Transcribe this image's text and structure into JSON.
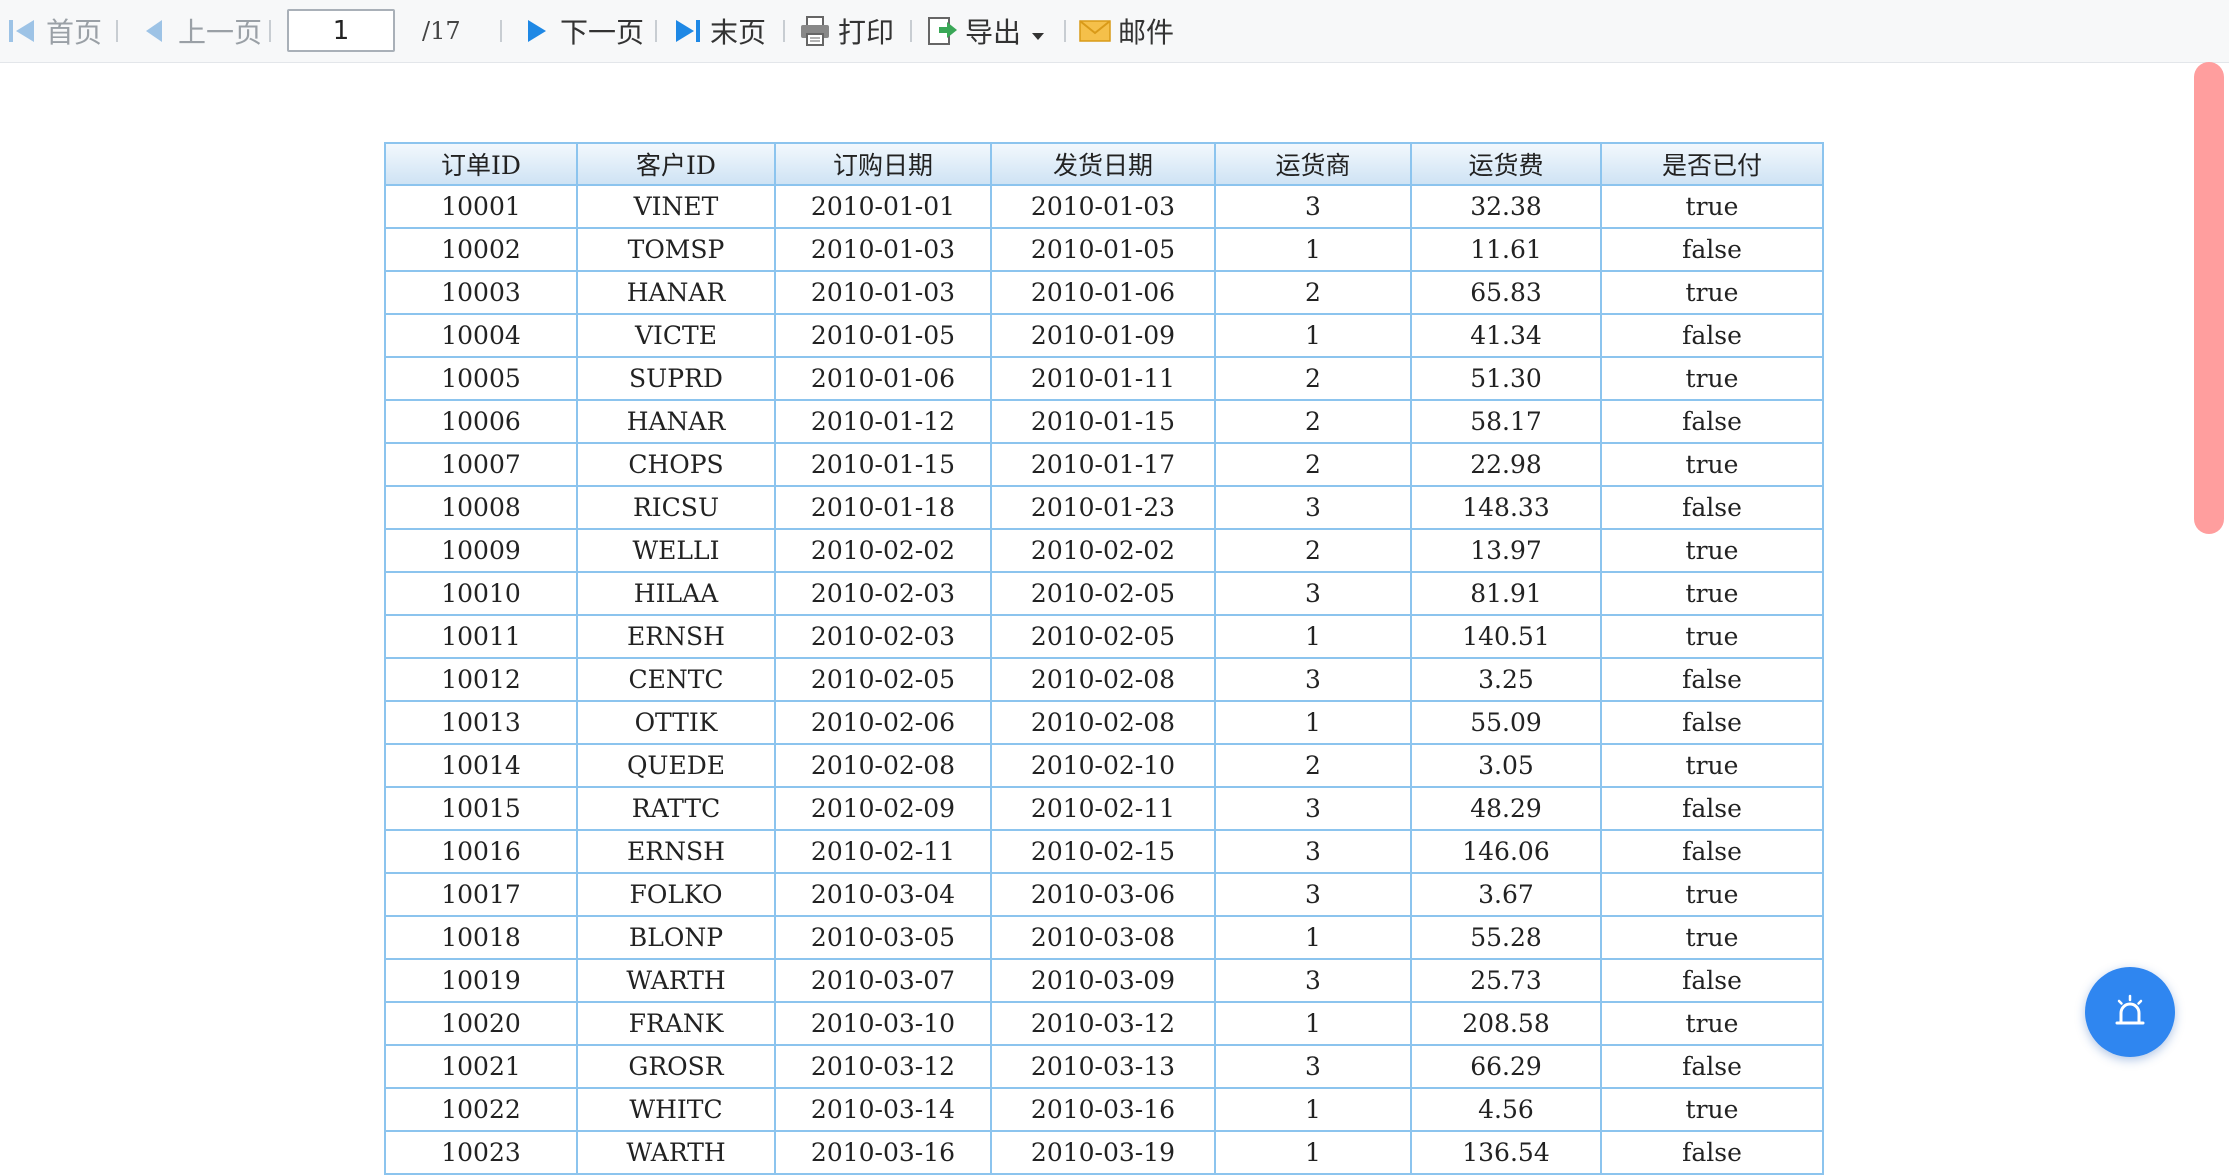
{
  "toolbar": {
    "first_label": "首页",
    "prev_label": "上一页",
    "page_value": "1",
    "page_total": "/17",
    "next_label": "下一页",
    "last_label": "末页",
    "print_label": "打印",
    "export_label": "导出",
    "mail_label": "邮件"
  },
  "icons": {
    "first": "first-page-icon",
    "prev": "prev-page-icon",
    "next": "next-page-icon",
    "last": "last-page-icon",
    "print": "printer-icon",
    "export": "export-icon",
    "export_dropdown": "caret-down-icon",
    "mail": "envelope-icon",
    "fab": "alarm-bell-icon"
  },
  "colors": {
    "accent": "#1e88e5",
    "table_border": "#8cc4ee",
    "scrollbar": "#ff9e9e",
    "fab": "#2f86f0"
  },
  "table": {
    "headers": [
      "订单ID",
      "客户ID",
      "订购日期",
      "发货日期",
      "运货商",
      "运货费",
      "是否已付"
    ],
    "rows": [
      [
        "10001",
        "VINET",
        "2010-01-01",
        "2010-01-03",
        "3",
        "32.38",
        "true"
      ],
      [
        "10002",
        "TOMSP",
        "2010-01-03",
        "2010-01-05",
        "1",
        "11.61",
        "false"
      ],
      [
        "10003",
        "HANAR",
        "2010-01-03",
        "2010-01-06",
        "2",
        "65.83",
        "true"
      ],
      [
        "10004",
        "VICTE",
        "2010-01-05",
        "2010-01-09",
        "1",
        "41.34",
        "false"
      ],
      [
        "10005",
        "SUPRD",
        "2010-01-06",
        "2010-01-11",
        "2",
        "51.30",
        "true"
      ],
      [
        "10006",
        "HANAR",
        "2010-01-12",
        "2010-01-15",
        "2",
        "58.17",
        "false"
      ],
      [
        "10007",
        "CHOPS",
        "2010-01-15",
        "2010-01-17",
        "2",
        "22.98",
        "true"
      ],
      [
        "10008",
        "RICSU",
        "2010-01-18",
        "2010-01-23",
        "3",
        "148.33",
        "false"
      ],
      [
        "10009",
        "WELLI",
        "2010-02-02",
        "2010-02-02",
        "2",
        "13.97",
        "true"
      ],
      [
        "10010",
        "HILAA",
        "2010-02-03",
        "2010-02-05",
        "3",
        "81.91",
        "true"
      ],
      [
        "10011",
        "ERNSH",
        "2010-02-03",
        "2010-02-05",
        "1",
        "140.51",
        "true"
      ],
      [
        "10012",
        "CENTC",
        "2010-02-05",
        "2010-02-08",
        "3",
        "3.25",
        "false"
      ],
      [
        "10013",
        "OTTIK",
        "2010-02-06",
        "2010-02-08",
        "1",
        "55.09",
        "false"
      ],
      [
        "10014",
        "QUEDE",
        "2010-02-08",
        "2010-02-10",
        "2",
        "3.05",
        "true"
      ],
      [
        "10015",
        "RATTC",
        "2010-02-09",
        "2010-02-11",
        "3",
        "48.29",
        "false"
      ],
      [
        "10016",
        "ERNSH",
        "2010-02-11",
        "2010-02-15",
        "3",
        "146.06",
        "false"
      ],
      [
        "10017",
        "FOLKO",
        "2010-03-04",
        "2010-03-06",
        "3",
        "3.67",
        "true"
      ],
      [
        "10018",
        "BLONP",
        "2010-03-05",
        "2010-03-08",
        "1",
        "55.28",
        "true"
      ],
      [
        "10019",
        "WARTH",
        "2010-03-07",
        "2010-03-09",
        "3",
        "25.73",
        "false"
      ],
      [
        "10020",
        "FRANK",
        "2010-03-10",
        "2010-03-12",
        "1",
        "208.58",
        "true"
      ],
      [
        "10021",
        "GROSR",
        "2010-03-12",
        "2010-03-13",
        "3",
        "66.29",
        "false"
      ],
      [
        "10022",
        "WHITC",
        "2010-03-14",
        "2010-03-16",
        "1",
        "4.56",
        "true"
      ],
      [
        "10023",
        "WARTH",
        "2010-03-16",
        "2010-03-19",
        "1",
        "136.54",
        "false"
      ]
    ]
  }
}
